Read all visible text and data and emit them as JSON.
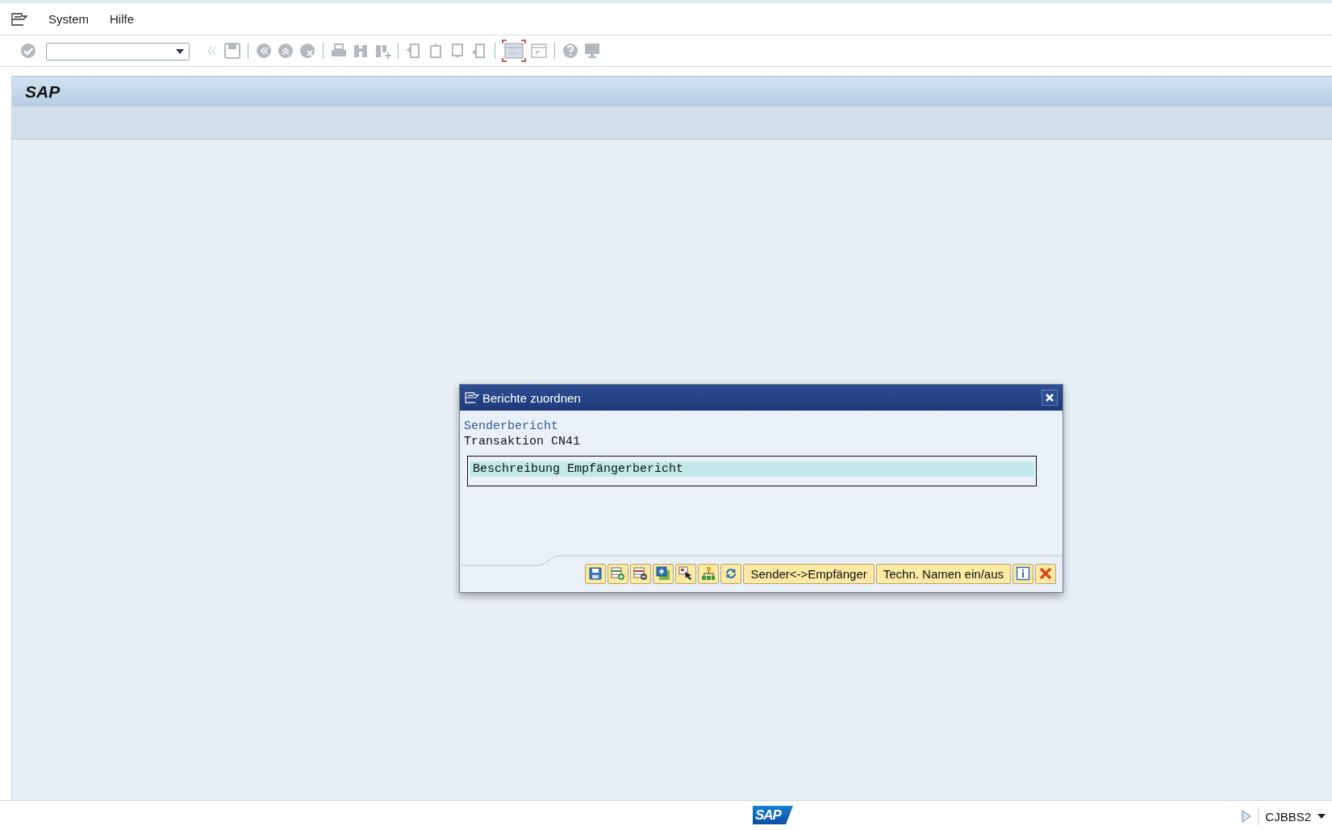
{
  "menu": [
    {
      "label": "System"
    },
    {
      "label": "Hilfe"
    }
  ],
  "screen": {
    "title": "SAP"
  },
  "dialog": {
    "title": "Berichte zuordnen",
    "sender_label": "Senderbericht",
    "sender_value": "Transaktion CN41",
    "list": [
      {
        "label": "Beschreibung Empfängerbericht",
        "selected": true
      }
    ],
    "buttons": [
      {
        "kind": "save"
      },
      {
        "kind": "insert-row"
      },
      {
        "kind": "delete-row"
      },
      {
        "kind": "add"
      },
      {
        "kind": "select"
      },
      {
        "kind": "hierarchy"
      },
      {
        "kind": "refresh"
      },
      {
        "kind": "text",
        "label": "Sender<->Empfänger"
      },
      {
        "kind": "text",
        "label": "Techn. Namen ein/aus"
      },
      {
        "kind": "info"
      },
      {
        "kind": "cancel"
      }
    ]
  },
  "status_bar": {
    "logo": "SAP",
    "system": "CJBBS2"
  }
}
